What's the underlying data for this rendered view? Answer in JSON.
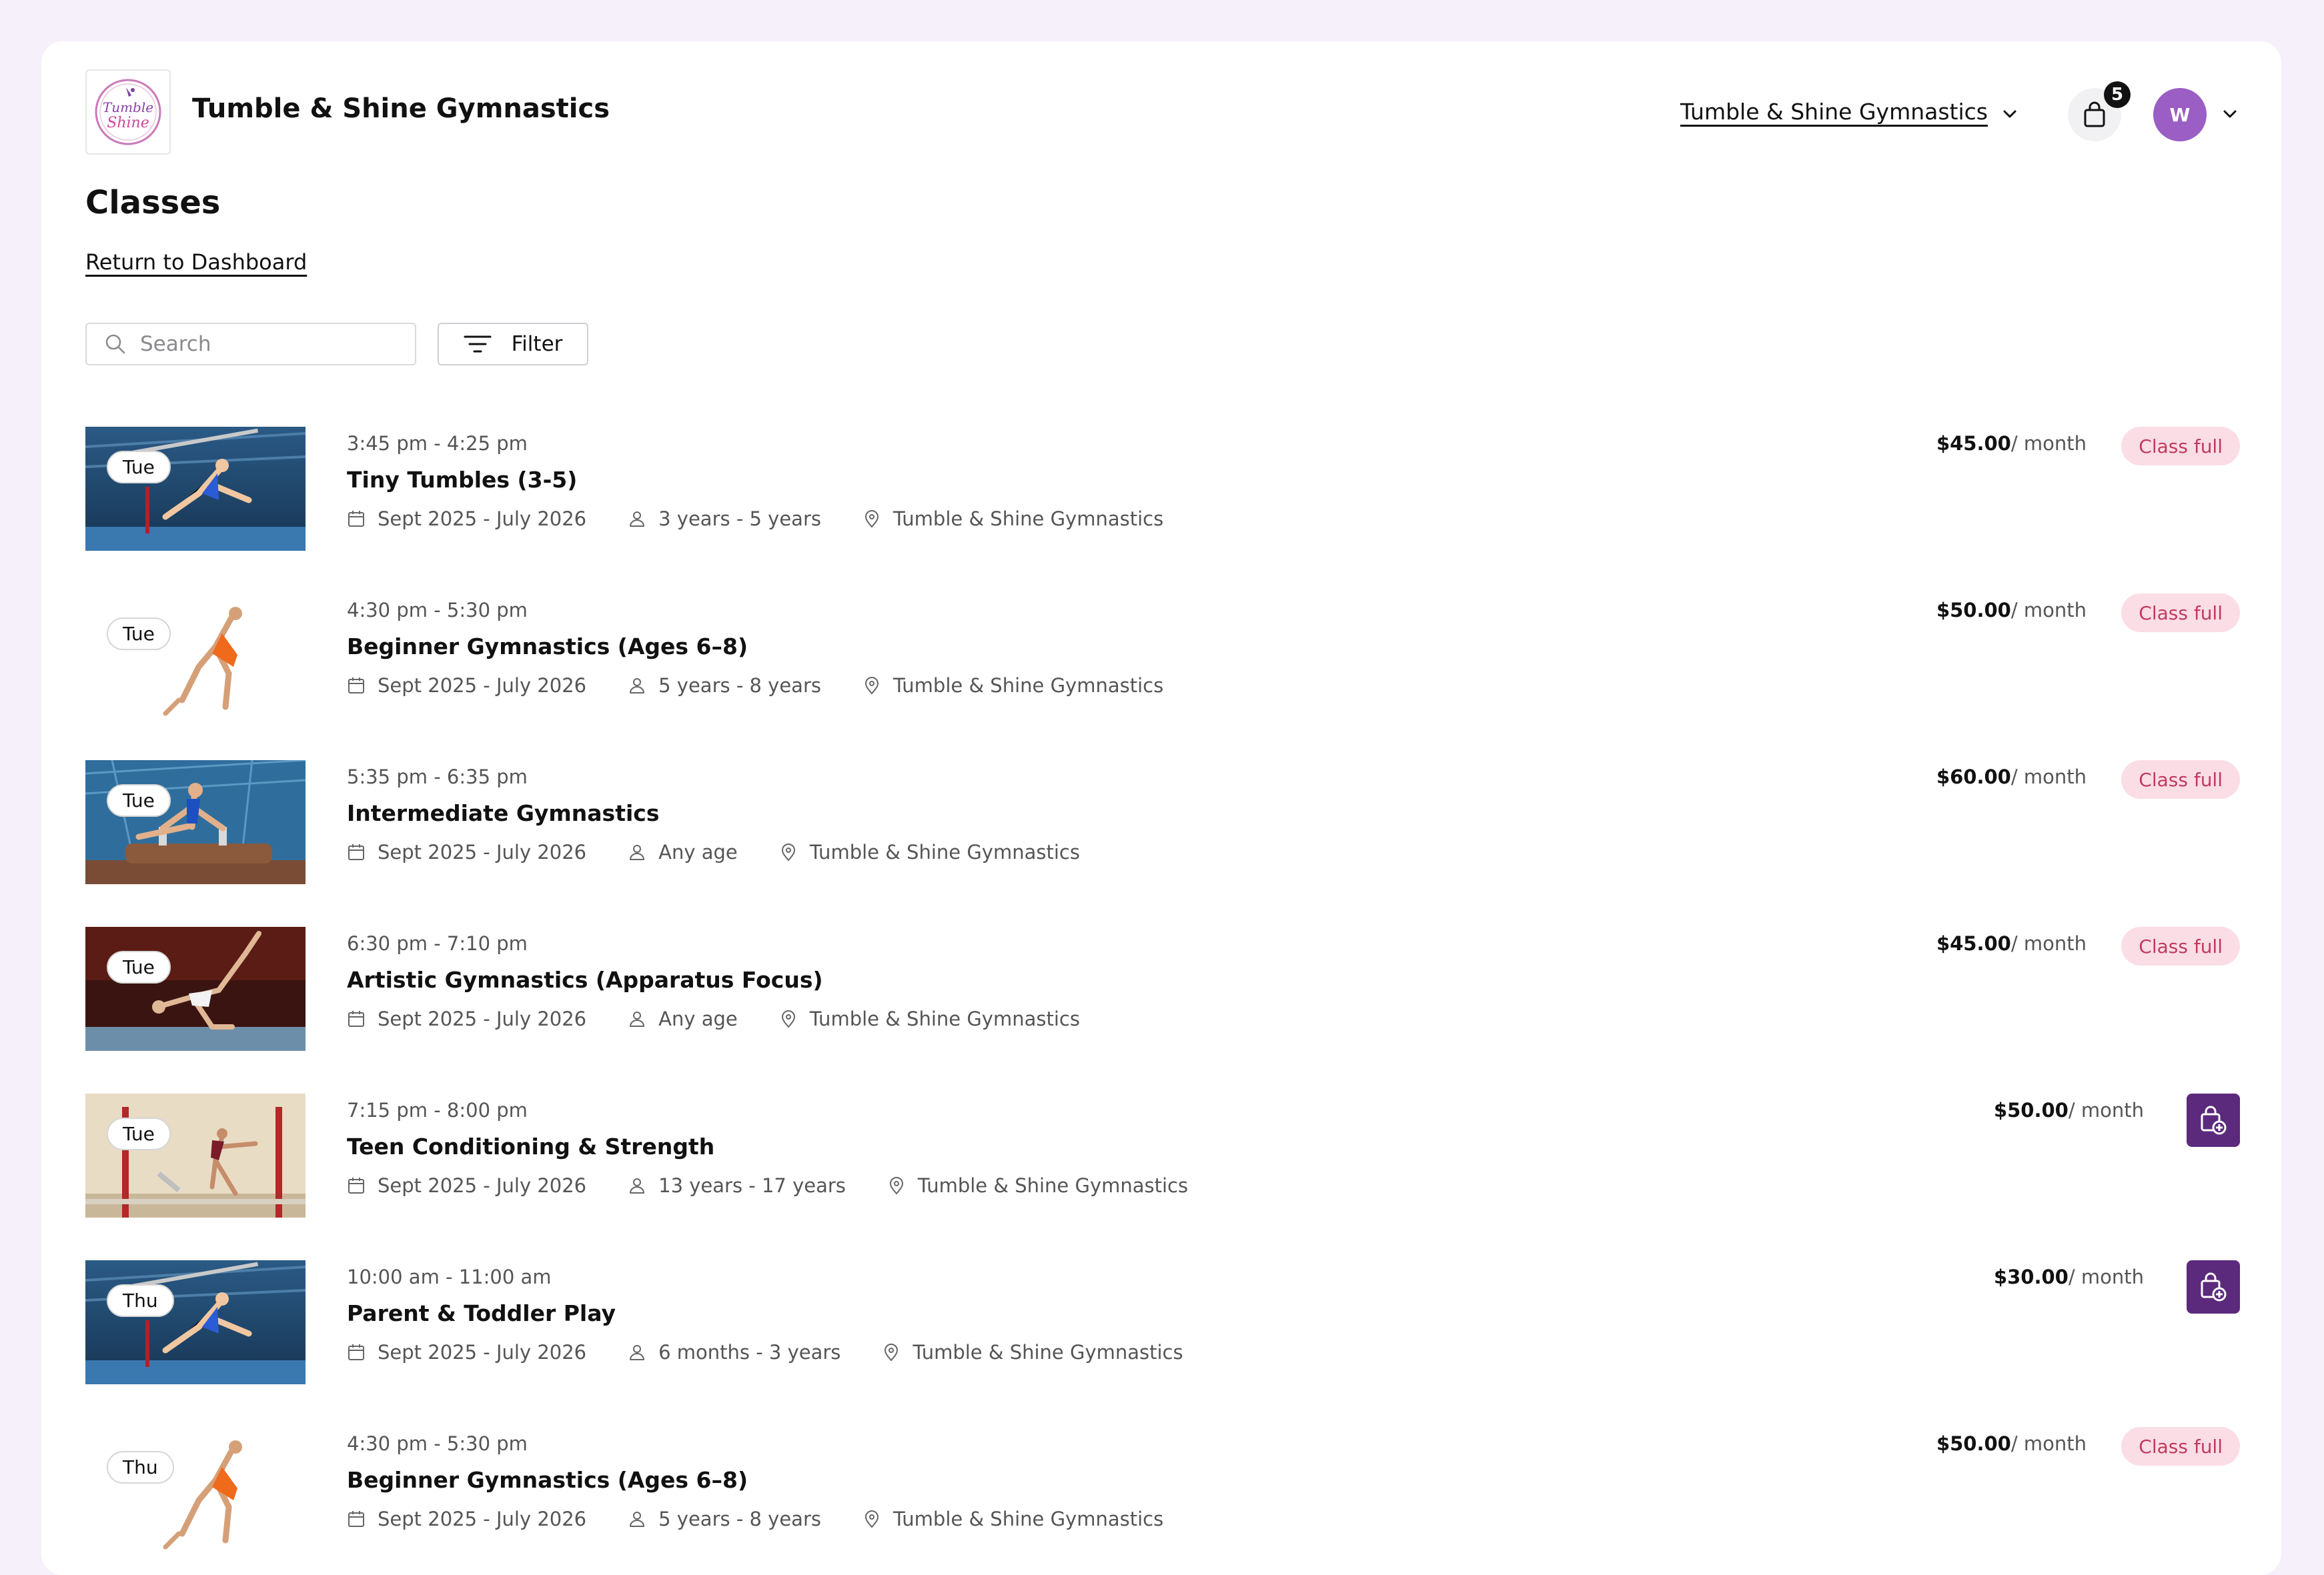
{
  "header": {
    "brand_title": "Tumble & Shine Gymnastics",
    "logo_text_1": "Tumble",
    "logo_text_2": "Shine",
    "org_select": "Tumble & Shine Gymnastics",
    "cart_count": "5",
    "avatar_initial": "W"
  },
  "page": {
    "title": "Classes",
    "return_link": "Return to Dashboard"
  },
  "toolbar": {
    "search_placeholder": "Search",
    "filter_label": "Filter"
  },
  "colors": {
    "accent": "#5b2a7c",
    "avatar": "#9a5ec4",
    "badge_full_bg": "#fbdde6",
    "badge_full_text": "#c13a60"
  },
  "classes": [
    {
      "day": "Tue",
      "time": "3:45 pm - 4:25 pm",
      "name": "Tiny Tumbles (3-5)",
      "dates": "Sept 2025 - July 2026",
      "ages": "3 years - 5 years",
      "location": "Tumble & Shine Gymnastics",
      "price": "$45.00",
      "per": "/ month",
      "status": "Class full",
      "thumb": "gym-blue"
    },
    {
      "day": "Tue",
      "time": "4:30 pm - 5:30 pm",
      "name": "Beginner Gymnastics (Ages 6–8)",
      "dates": "Sept 2025 - July 2026",
      "ages": "5 years - 8 years",
      "location": "Tumble & Shine Gymnastics",
      "price": "$50.00",
      "per": "/ month",
      "status": "Class full",
      "thumb": "white"
    },
    {
      "day": "Tue",
      "time": "5:35 pm - 6:35 pm",
      "name": "Intermediate Gymnastics",
      "dates": "Sept 2025 - July 2026",
      "ages": "Any age",
      "location": "Tumble & Shine Gymnastics",
      "price": "$60.00",
      "per": "/ month",
      "status": "Class full",
      "thumb": "pommel"
    },
    {
      "day": "Tue",
      "time": "6:30 pm - 7:10 pm",
      "name": "Artistic Gymnastics (Apparatus Focus)",
      "dates": "Sept 2025 - July 2026",
      "ages": "Any age",
      "location": "Tumble & Shine Gymnastics",
      "price": "$45.00",
      "per": "/ month",
      "status": "Class full",
      "thumb": "dark"
    },
    {
      "day": "Tue",
      "time": "7:15 pm - 8:00 pm",
      "name": "Teen Conditioning & Strength",
      "dates": "Sept 2025 - July 2026",
      "ages": "13 years - 17 years",
      "location": "Tumble & Shine Gymnastics",
      "price": "$50.00",
      "per": "/ month",
      "status": "",
      "thumb": "beige"
    },
    {
      "day": "Thu",
      "time": "10:00 am - 11:00 am",
      "name": "Parent & Toddler Play",
      "dates": "Sept 2025 - July 2026",
      "ages": "6 months - 3 years",
      "location": "Tumble & Shine Gymnastics",
      "price": "$30.00",
      "per": "/ month",
      "status": "",
      "thumb": "gym-blue"
    },
    {
      "day": "Thu",
      "time": "4:30 pm - 5:30 pm",
      "name": "Beginner Gymnastics (Ages 6–8)",
      "dates": "Sept 2025 - July 2026",
      "ages": "5 years - 8 years",
      "location": "Tumble & Shine Gymnastics",
      "price": "$50.00",
      "per": "/ month",
      "status": "Class full",
      "thumb": "white"
    }
  ]
}
